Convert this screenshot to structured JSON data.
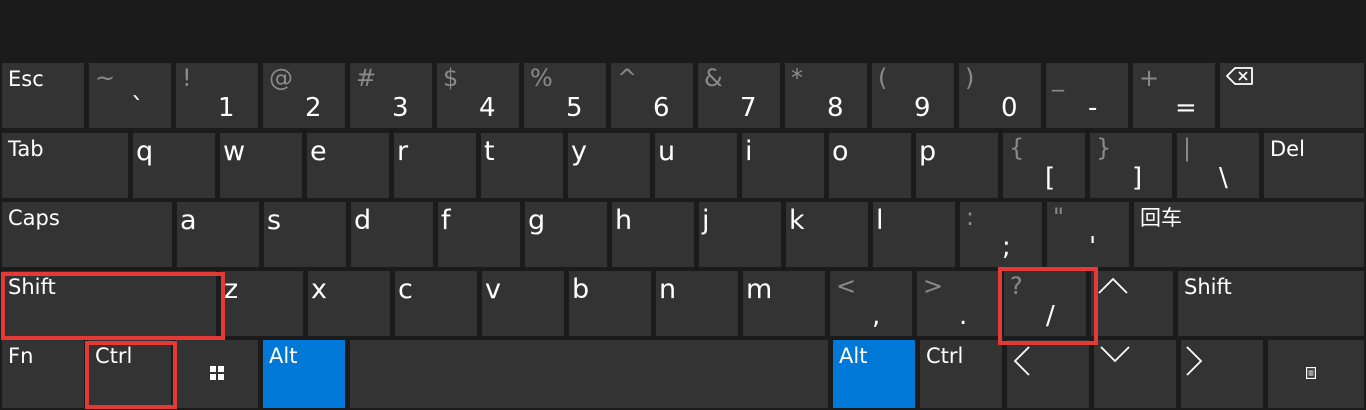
{
  "colors": {
    "key": "#333333",
    "accent": "#0078d7",
    "highlight": "#e53935",
    "background": "#1b1b1b"
  },
  "rows": {
    "number": {
      "esc": "Esc",
      "keys": [
        {
          "sec": "~",
          "main": "`"
        },
        {
          "sec": "!",
          "main": "1"
        },
        {
          "sec": "@",
          "main": "2"
        },
        {
          "sec": "#",
          "main": "3"
        },
        {
          "sec": "$",
          "main": "4"
        },
        {
          "sec": "%",
          "main": "5"
        },
        {
          "sec": "^",
          "main": "6"
        },
        {
          "sec": "&",
          "main": "7"
        },
        {
          "sec": "*",
          "main": "8"
        },
        {
          "sec": "(",
          "main": "9"
        },
        {
          "sec": ")",
          "main": "0"
        },
        {
          "sec": "_",
          "main": "-"
        },
        {
          "sec": "+",
          "main": "="
        }
      ],
      "backspace_icon": "backspace-icon"
    },
    "top": {
      "tab": "Tab",
      "letters": [
        "q",
        "w",
        "e",
        "r",
        "t",
        "y",
        "u",
        "i",
        "o",
        "p"
      ],
      "brackets": [
        {
          "sec": "{",
          "main": "["
        },
        {
          "sec": "}",
          "main": "]"
        },
        {
          "sec": "|",
          "main": "\\"
        }
      ],
      "del": "Del"
    },
    "home": {
      "caps": "Caps",
      "letters": [
        "a",
        "s",
        "d",
        "f",
        "g",
        "h",
        "j",
        "k",
        "l"
      ],
      "punct": [
        {
          "sec": ":",
          "main": ";"
        },
        {
          "sec": "\"",
          "main": "'"
        }
      ],
      "enter": "回车"
    },
    "bottom": {
      "shift_left": "Shift",
      "letters": [
        "z",
        "x",
        "c",
        "v",
        "b",
        "n",
        "m"
      ],
      "punct": [
        {
          "sec": "<",
          "main": ","
        },
        {
          "sec": ">",
          "main": "."
        },
        {
          "sec": "?",
          "main": "/"
        }
      ],
      "up_icon": "chevron-up-icon",
      "shift_right": "Shift"
    },
    "space": {
      "fn": "Fn",
      "ctrl_left": "Ctrl",
      "windows_icon": "windows-icon",
      "alt_left": "Alt",
      "alt_right": "Alt",
      "ctrl_right": "Ctrl",
      "left_icon": "chevron-left-icon",
      "down_icon": "chevron-down-icon",
      "right_icon": "chevron-right-icon",
      "menu_icon": "menu-icon"
    }
  }
}
